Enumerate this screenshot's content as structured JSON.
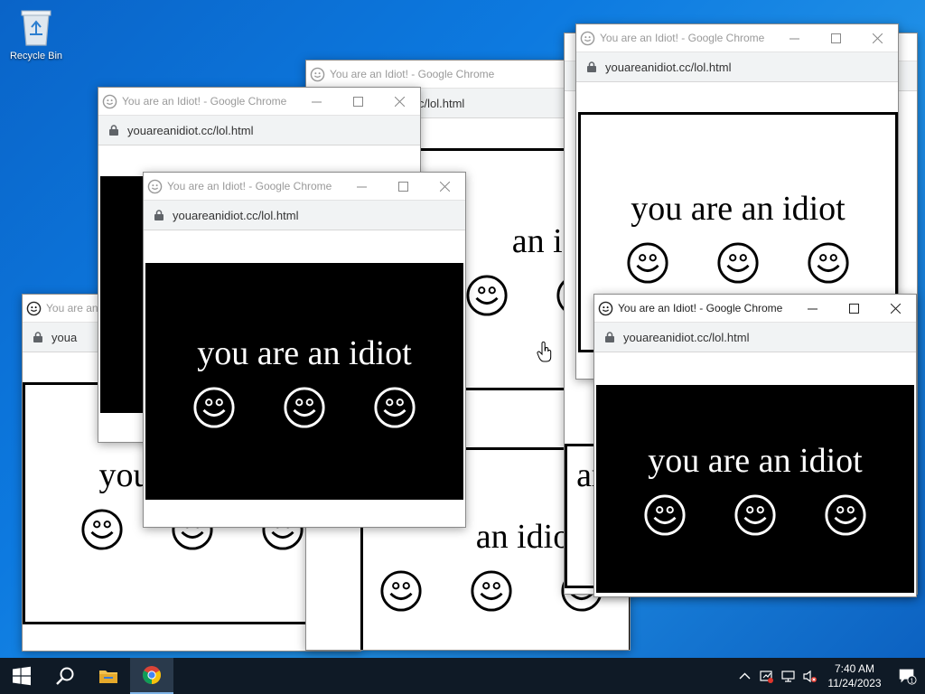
{
  "desktop": {
    "icons": [
      {
        "label": "Recycle Bin",
        "icon": "recycle-bin-icon"
      }
    ]
  },
  "browser": {
    "title": "You are an Idiot! - Google Chrome",
    "url": "youareanidiot.cc/lol.html",
    "page_text": "you are an idiot",
    "face_icon": "smiley-face-icon"
  },
  "windows": [
    {
      "id": "w1",
      "partial_title": "You are an Idiot!",
      "partial_url": "youa",
      "partial_text": "you"
    },
    {
      "id": "w4",
      "partial_url": "c/lol.html",
      "partial_text": "an idio"
    },
    {
      "id": "w5",
      "partial_text": "an idio"
    },
    {
      "id": "w6",
      "partial_text": "an"
    }
  ],
  "taskbar": {
    "items": [
      {
        "name": "start",
        "icon": "windows-logo-icon"
      },
      {
        "name": "search",
        "icon": "search-icon"
      },
      {
        "name": "file-explorer",
        "icon": "folder-icon"
      },
      {
        "name": "chrome",
        "icon": "chrome-icon"
      }
    ],
    "clock": {
      "time": "7:40 AM",
      "date": "11/24/2023"
    },
    "notification_count": "1"
  },
  "colors": {
    "desktop": "#0a64c8",
    "taskbar": "#0f1a26",
    "address_bar": "#f1f3f4"
  }
}
